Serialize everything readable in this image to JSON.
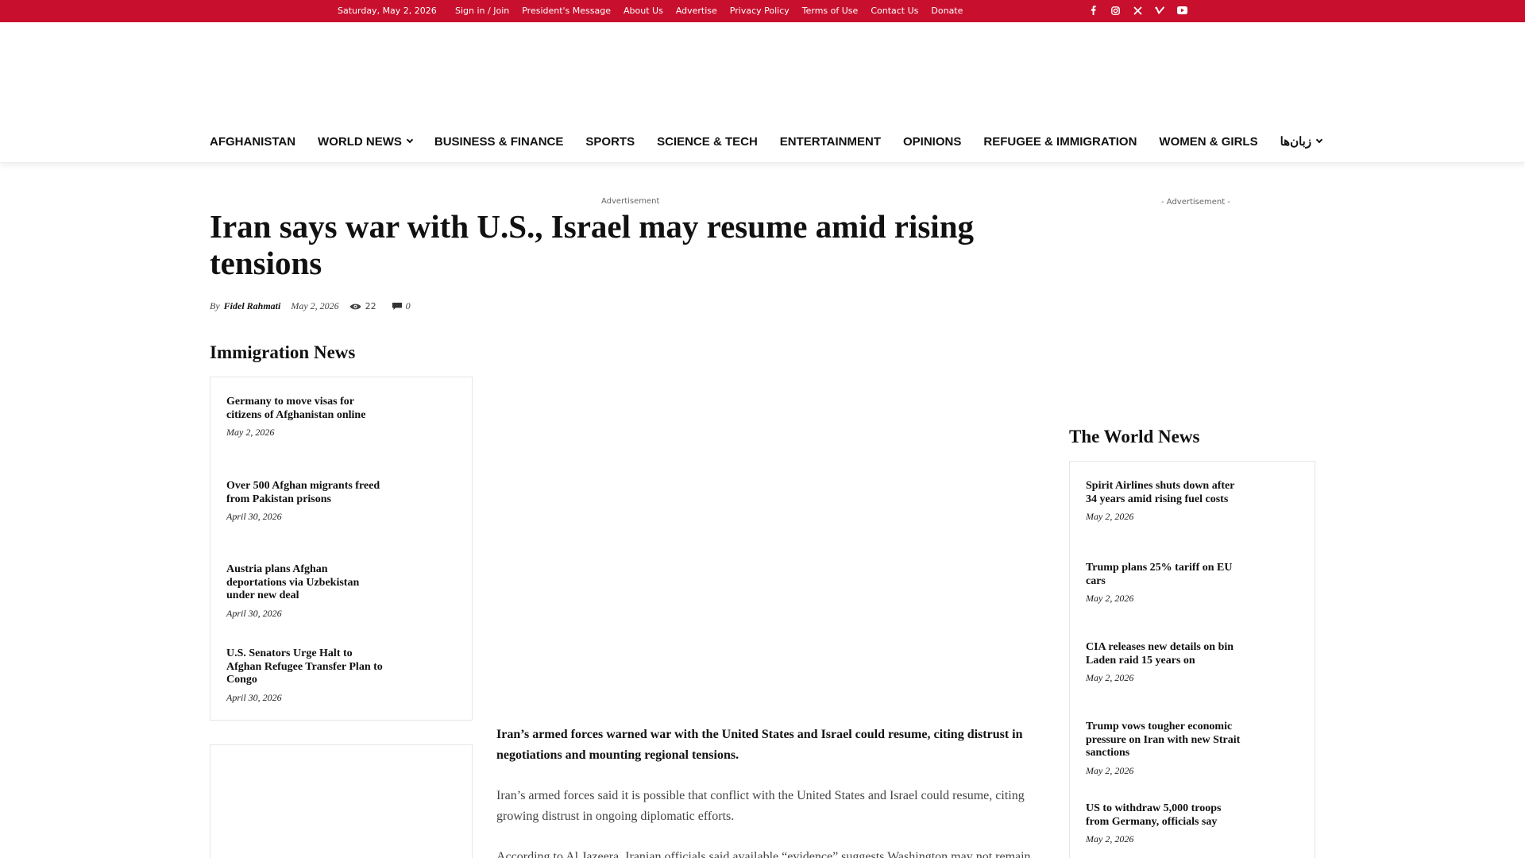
{
  "topbar": {
    "date": "Saturday, May 2, 2026",
    "links": [
      "Sign in / Join",
      "President's Message",
      "About Us",
      "Advertise",
      "Privacy Policy",
      "Terms of Use",
      "Contact Us",
      "Donate"
    ],
    "social_icons": [
      "facebook-icon",
      "instagram-icon",
      "x-icon",
      "vimeo-icon",
      "youtube-icon"
    ],
    "color": "#c8102e"
  },
  "nav": {
    "items": [
      {
        "label": "AFGHANISTAN",
        "dropdown": false
      },
      {
        "label": "WORLD NEWS",
        "dropdown": true
      },
      {
        "label": "BUSINESS & FINANCE",
        "dropdown": false
      },
      {
        "label": "SPORTS",
        "dropdown": false
      },
      {
        "label": "SCIENCE & TECH",
        "dropdown": false
      },
      {
        "label": "ENTERTAINMENT",
        "dropdown": false
      },
      {
        "label": "OPINIONS",
        "dropdown": false
      },
      {
        "label": "REFUGEE & IMMIGRATION",
        "dropdown": false
      },
      {
        "label": "WOMEN & GIRLS",
        "dropdown": false
      },
      {
        "label": "زبان‌ها",
        "dropdown": true
      }
    ]
  },
  "ads": {
    "center_label": "Advertisement",
    "sidebar_label": "- Advertisement -"
  },
  "article": {
    "title": "Iran says war with U.S., Israel may resume amid rising tensions",
    "by": "By",
    "author": "Fidel Rahmati",
    "date": "May 2, 2026",
    "views": "22",
    "comments": "0",
    "lead": "Iran’s armed forces warned war with the United States and Israel could resume, citing distrust in negotiations and mounting regional tensions.",
    "paragraphs": [
      "Iran’s armed forces said it is possible that conflict with the United States and Israel could resume, citing growing distrust in ongoing diplomatic efforts.",
      "According to Al Jazeera, Iranian officials said available “evidence” suggests Washington may not remain"
    ]
  },
  "immigration_news": {
    "title": "Immigration News",
    "items": [
      {
        "headline": "Germany to move visas for citizens of Afghanistan online",
        "date": "May 2, 2026"
      },
      {
        "headline": "Over 500 Afghan migrants freed from Pakistan prisons",
        "date": "April 30, 2026"
      },
      {
        "headline": "Austria plans Afghan deportations via Uzbekistan under new deal",
        "date": "April 30, 2026"
      },
      {
        "headline": "U.S. Senators Urge Halt to Afghan Refugee Transfer Plan to Congo",
        "date": "April 30, 2026"
      }
    ]
  },
  "world_news": {
    "title": "The World News",
    "items": [
      {
        "headline": "Spirit Airlines shuts down after 34 years amid rising fuel costs",
        "date": "May 2, 2026"
      },
      {
        "headline": "Trump plans 25% tariff on EU cars",
        "date": "May 2, 2026"
      },
      {
        "headline": "CIA releases new details on bin Laden raid 15 years on",
        "date": "May 2, 2026"
      },
      {
        "headline": "Trump vows tougher economic pressure on Iran with new Strait sanctions",
        "date": "May 2, 2026"
      },
      {
        "headline": "US to withdraw 5,000 troops from Germany, officials say",
        "date": "May 2, 2026"
      }
    ]
  }
}
